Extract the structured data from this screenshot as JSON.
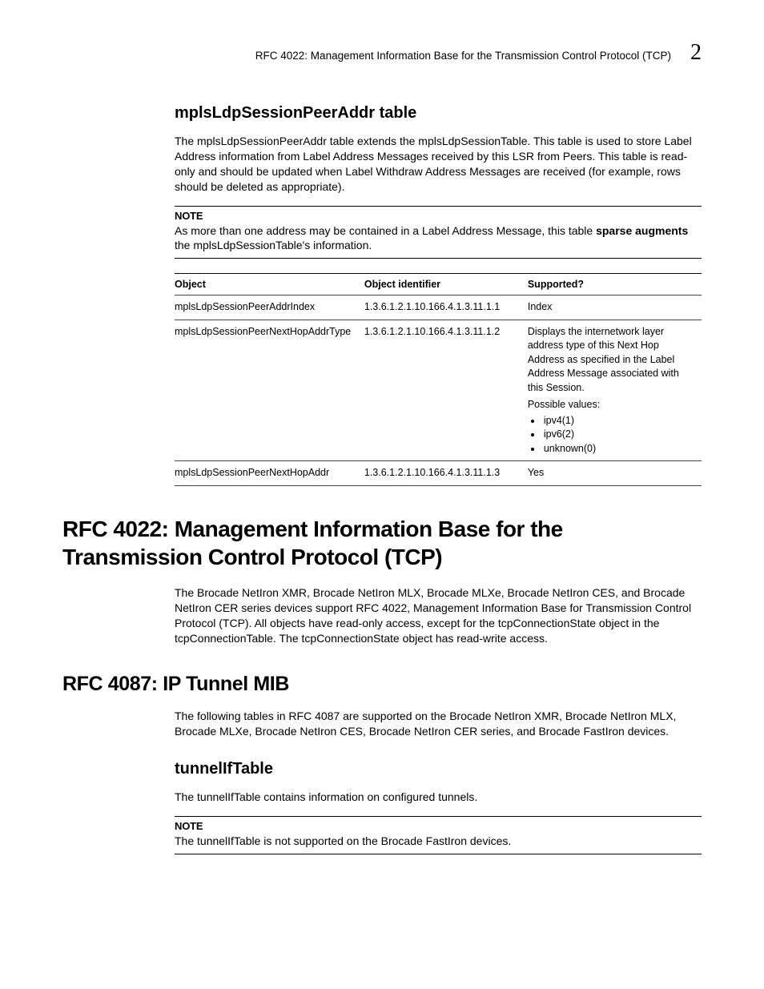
{
  "header": {
    "text": "RFC 4022: Management Information Base for the Transmission Control Protocol (TCP)",
    "page_num": "2"
  },
  "section1": {
    "heading": "mplsLdpSessionPeerAddr table",
    "para": "The mplsLdpSessionPeerAddr table extends the mplsLdpSessionTable. This table is used to store Label Address information from Label Address Messages received by this LSR from Peers. This table is read-only and should be updated when Label Withdraw Address Messages are received (for example, rows should be deleted as appropriate).",
    "note": {
      "label": "NOTE",
      "body_pre": "As more than one address may be contained in a Label Address Message, this table ",
      "bold1": "sparse augments",
      "body_post": " the mplsLdpSessionTable's information."
    },
    "table": {
      "headers": {
        "c1": "Object",
        "c2": "Object identifier",
        "c3": "Supported?"
      },
      "rows": [
        {
          "obj": "mplsLdpSessionPeerAddrIndex",
          "oid": "1.3.6.1.2.1.10.166.4.1.3.11.1.1",
          "sup": "Index"
        },
        {
          "obj": "mplsLdpSessionPeerNextHopAddrType",
          "oid": "1.3.6.1.2.1.10.166.4.1.3.11.1.2",
          "sup_text": "Displays the internetwork layer address type of this Next Hop Address as specified in the Label Address Message associated with this Session.",
          "sup_text2": "Possible values:",
          "sup_list": [
            "ipv4(1)",
            "ipv6(2)",
            "unknown(0)"
          ]
        },
        {
          "obj": "mplsLdpSessionPeerNextHopAddr",
          "oid": "1.3.6.1.2.1.10.166.4.1.3.11.1.3",
          "sup": "Yes"
        }
      ]
    }
  },
  "section2": {
    "heading": "RFC 4022: Management Information Base for the Transmission Control Protocol (TCP)",
    "para": "The Brocade NetIron XMR, Brocade NetIron MLX, Brocade MLXe, Brocade NetIron CES, and Brocade NetIron CER series devices support RFC 4022, Management Information Base for Transmission Control Protocol (TCP). All objects have read-only access, except for the tcpConnectionState object in the tcpConnectionTable. The tcpConnectionState object has read-write access."
  },
  "section3": {
    "heading": "RFC 4087: IP Tunnel MIB",
    "para": "The following tables in RFC 4087 are supported on the Brocade NetIron XMR, Brocade NetIron MLX, Brocade MLXe, Brocade NetIron CES, Brocade NetIron CER series, and Brocade FastIron devices.",
    "sub": {
      "heading": "tunnelIfTable",
      "para": "The tunnelIfTable contains information on configured tunnels.",
      "note": {
        "label": "NOTE",
        "body": "The tunnelIfTable is not supported on the Brocade FastIron devices."
      }
    }
  }
}
